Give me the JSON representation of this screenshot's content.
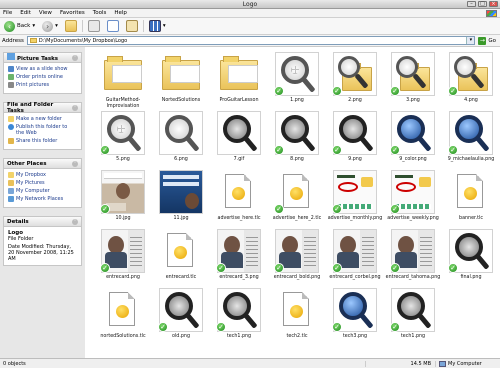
{
  "window": {
    "title": "Logo"
  },
  "menu": [
    "File",
    "Edit",
    "View",
    "Favorites",
    "Tools",
    "Help"
  ],
  "toolbar": {
    "back_label": "Back"
  },
  "address": {
    "label": "Address",
    "path": "D:\\MyDocuments\\My Dropbox\\Logo",
    "go_label": "Go"
  },
  "sidebar": {
    "picture_tasks": {
      "title": "Picture Tasks",
      "items": [
        "View as a slide show",
        "Order prints online",
        "Print pictures"
      ]
    },
    "file_folder_tasks": {
      "title": "File and Folder Tasks",
      "items": [
        "Make a new folder",
        "Publish this folder to the Web",
        "Share this folder"
      ]
    },
    "other_places": {
      "title": "Other Places",
      "items": [
        "My Dropbox",
        "My Pictures",
        "My Computer",
        "My Network Places"
      ]
    },
    "details": {
      "title": "Details",
      "name": "Logo",
      "type": "File Folder",
      "modified": "Date Modified: Thursday, 20 November 2008, 11:25 AM"
    }
  },
  "files": [
    {
      "name": "GuitarMethod-Improvisation",
      "kind": "folder",
      "check": false
    },
    {
      "name": "NortedSolutions",
      "kind": "folder",
      "check": false
    },
    {
      "name": "ProGuitarLesson",
      "kind": "folder",
      "check": false
    },
    {
      "name": "1.png",
      "kind": "mag-grid",
      "check": true
    },
    {
      "name": "2.png",
      "kind": "folder-mag",
      "check": true
    },
    {
      "name": "3.png",
      "kind": "folder-mag",
      "check": true
    },
    {
      "name": "4.png",
      "kind": "folder-mag",
      "check": true
    },
    {
      "name": "5.png",
      "kind": "mag-grid",
      "check": true
    },
    {
      "name": "6.png",
      "kind": "mag-blur",
      "check": false
    },
    {
      "name": "7.gif",
      "kind": "mag-dark",
      "check": false
    },
    {
      "name": "8.png",
      "kind": "mag-dark",
      "check": true
    },
    {
      "name": "9.png",
      "kind": "mag-dark",
      "check": true
    },
    {
      "name": "9_color.png",
      "kind": "mag-globe",
      "check": true
    },
    {
      "name": "9_michaelaulia.png",
      "kind": "mag-globe",
      "check": true
    },
    {
      "name": "10.jpg",
      "kind": "photo-michael",
      "check": true
    },
    {
      "name": "11.jpg",
      "kind": "photo-tech",
      "check": false
    },
    {
      "name": "advertise_here.tlc",
      "kind": "doc",
      "check": false
    },
    {
      "name": "advertise_here_2.tlc",
      "kind": "doc",
      "check": true
    },
    {
      "name": "advertise_monthly.png",
      "kind": "ad",
      "check": true
    },
    {
      "name": "advertise_weekly.png",
      "kind": "ad",
      "check": true
    },
    {
      "name": "banner.tlc",
      "kind": "doc",
      "check": false
    },
    {
      "name": "entrecard.png",
      "kind": "photo-person",
      "check": true
    },
    {
      "name": "entrecard.tlc",
      "kind": "doc",
      "check": false
    },
    {
      "name": "entrecard_3.png",
      "kind": "photo-person",
      "check": true
    },
    {
      "name": "entrecard_bold.png",
      "kind": "photo-person",
      "check": true
    },
    {
      "name": "entrecard_corbel.png",
      "kind": "photo-person",
      "check": true
    },
    {
      "name": "entrecard_tahoma.png",
      "kind": "photo-person",
      "check": true
    },
    {
      "name": "final.png",
      "kind": "mag-dark",
      "check": true
    },
    {
      "name": "nortedSolutions.tlc",
      "kind": "doc",
      "check": false
    },
    {
      "name": "old.png",
      "kind": "mag-dark",
      "check": true
    },
    {
      "name": "tech1.png",
      "kind": "mag-dark",
      "check": true
    },
    {
      "name": "tech2.tlc",
      "kind": "doc",
      "check": false
    },
    {
      "name": "tech3.png",
      "kind": "mag-globe",
      "check": true
    },
    {
      "name": "tech1.png",
      "kind": "mag-dark",
      "check": true
    }
  ],
  "status": {
    "objects": "0 objects",
    "size": "14.5 MB",
    "location": "My Computer"
  }
}
